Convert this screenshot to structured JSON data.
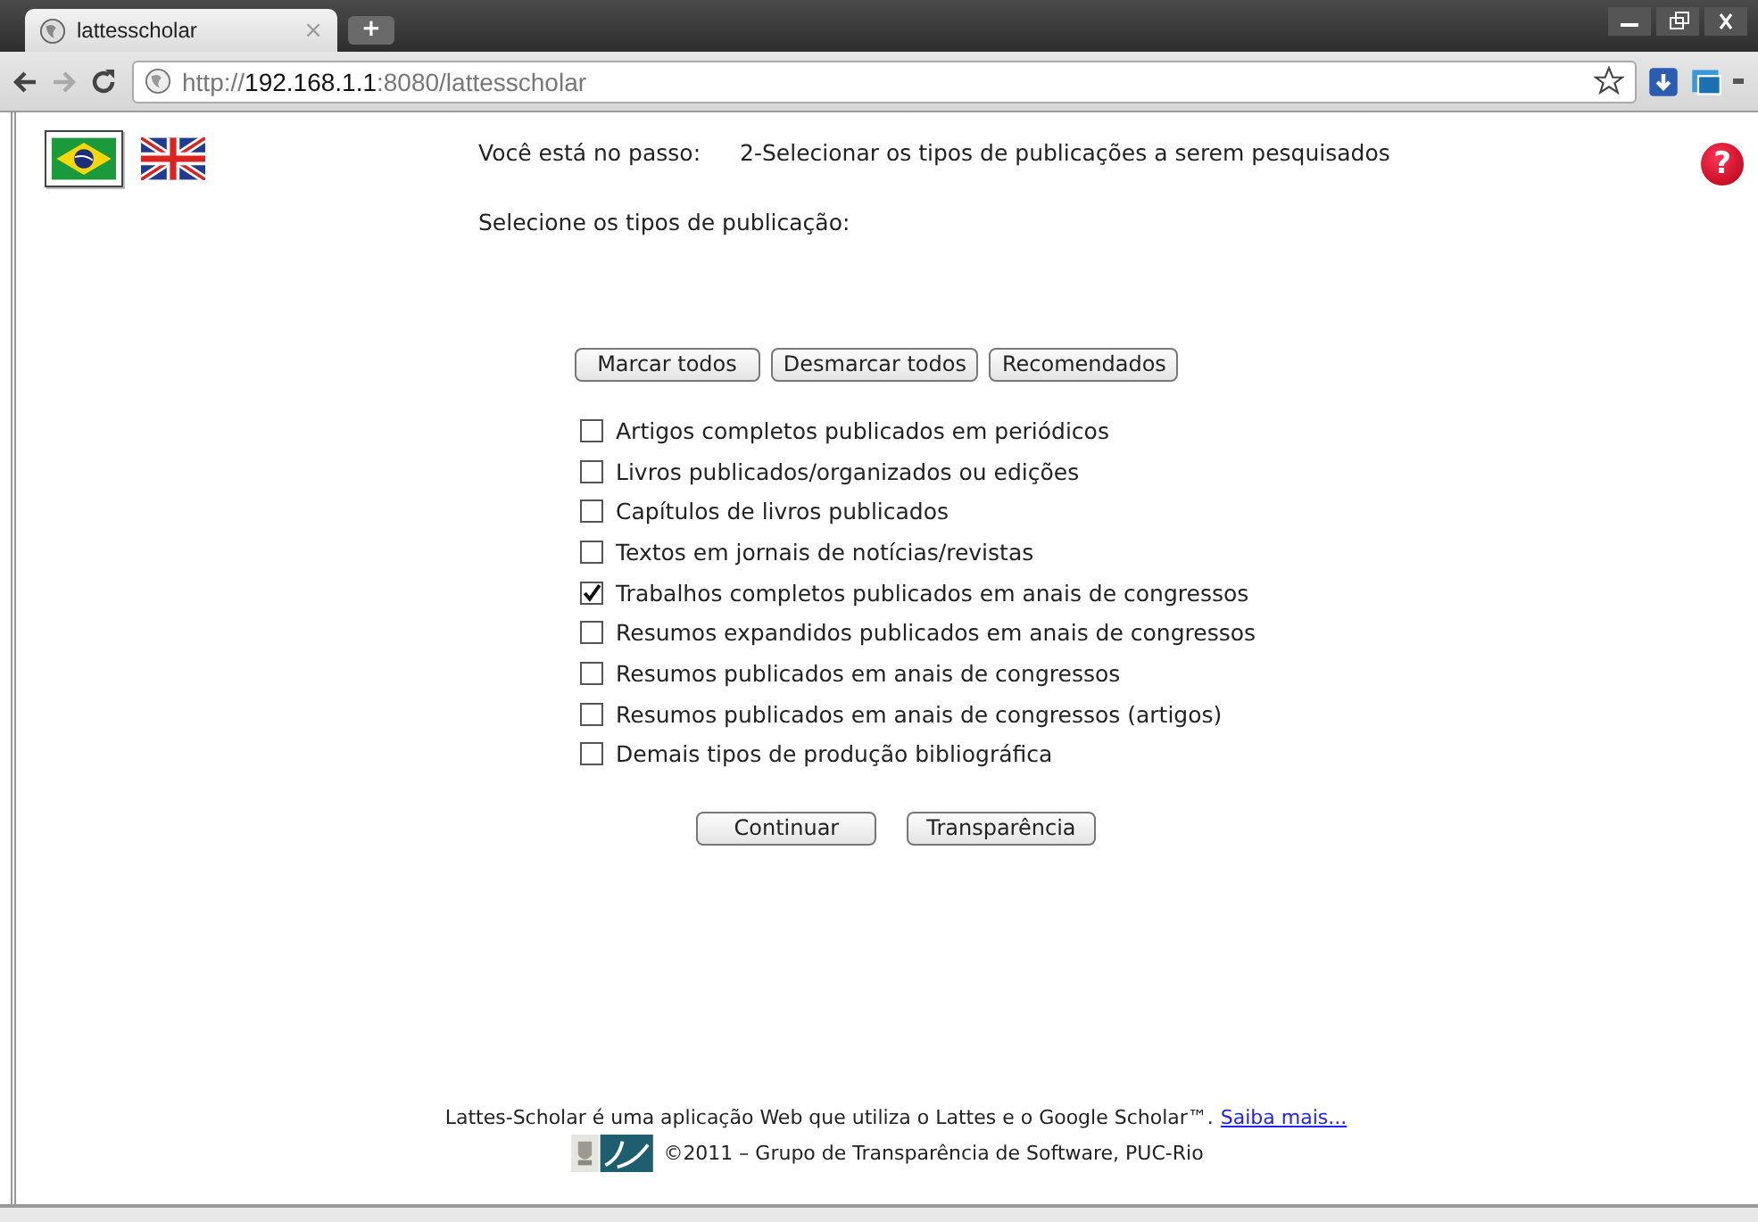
{
  "browser": {
    "tab": {
      "title": "lattesscholar",
      "close": "×"
    },
    "new_tab": "+",
    "address": {
      "scheme": "http://",
      "host": "192.168.1.1",
      "rest": ":8080/lattesscholar"
    }
  },
  "languages": [
    {
      "kind": "br",
      "selected": true
    },
    {
      "kind": "uk",
      "selected": false
    }
  ],
  "step": {
    "label": "Você está no passo:",
    "value": "2-Selecionar os tipos de publicações a serem pesquisados"
  },
  "help": "?",
  "prompt": "Selecione os tipos de publicação:",
  "bulk_buttons": [
    "Marcar todos",
    "Desmarcar todos",
    "Recomendados"
  ],
  "publication_types": [
    {
      "label": "Artigos completos publicados em periódicos",
      "checked": false
    },
    {
      "label": "Livros publicados/organizados ou edições",
      "checked": false
    },
    {
      "label": "Capítulos de livros publicados",
      "checked": false
    },
    {
      "label": "Textos em jornais de notícias/revistas",
      "checked": false
    },
    {
      "label": "Trabalhos completos publicados em anais de congressos",
      "checked": true
    },
    {
      "label": "Resumos expandidos publicados em anais de congressos",
      "checked": false
    },
    {
      "label": "Resumos publicados em anais de congressos",
      "checked": false
    },
    {
      "label": "Resumos publicados em anais de congressos (artigos)",
      "checked": false
    },
    {
      "label": "Demais tipos de produção bibliográfica",
      "checked": false
    }
  ],
  "actions": [
    "Continuar",
    "Transparência"
  ],
  "footer": {
    "text": "Lattes-Scholar é uma aplicação Web que utiliza o Lattes e o Google Scholar™.",
    "link": "Saiba mais...",
    "copyright": "©2011 – Grupo de Transparência de Software, PUC-Rio"
  }
}
